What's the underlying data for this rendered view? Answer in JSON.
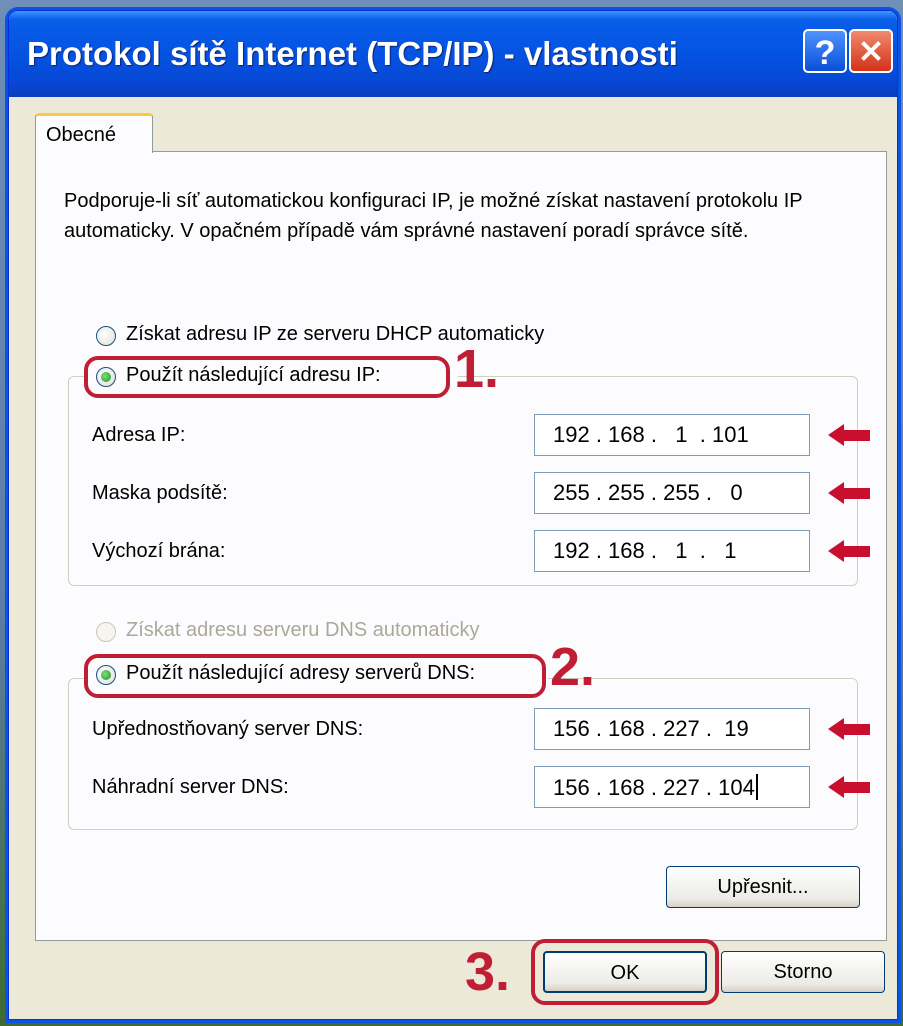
{
  "window": {
    "title": "Protokol sítě Internet (TCP/IP) - vlastnosti",
    "help_label": "?"
  },
  "tabs": [
    {
      "label": "Obecné",
      "active": true
    }
  ],
  "description": "Podporuje-li síť automatickou konfiguraci IP, je možné získat nastavení protokolu IP automaticky. V opačném případě vám správné nastavení poradí správce sítě.",
  "ip_section": {
    "auto_label": "Získat adresu IP ze serveru DHCP automaticky",
    "manual_label": "Použít následující adresu IP:",
    "selected": "manual",
    "fields": [
      {
        "label": "Adresa IP:",
        "value": "192 . 168 .   1  . 101"
      },
      {
        "label": "Maska podsítě:",
        "value": "255 . 255 . 255 .   0"
      },
      {
        "label": "Výchozí brána:",
        "value": "192 . 168 .   1  .   1"
      }
    ]
  },
  "dns_section": {
    "auto_label": "Získat adresu serveru DNS automaticky",
    "auto_disabled": true,
    "manual_label": "Použít následující adresy serverů DNS:",
    "selected": "manual",
    "fields": [
      {
        "label": "Upřednostňovaný server DNS:",
        "value": "156 . 168 . 227 .  19"
      },
      {
        "label": "Náhradní server DNS:",
        "value": "156 . 168 . 227 . 104"
      }
    ]
  },
  "advanced_button": "Upřesnit...",
  "ok_button": "OK",
  "cancel_button": "Storno",
  "annotations": {
    "step1": "1.",
    "step2": "2.",
    "step3": "3.",
    "color": "#c01e35"
  }
}
